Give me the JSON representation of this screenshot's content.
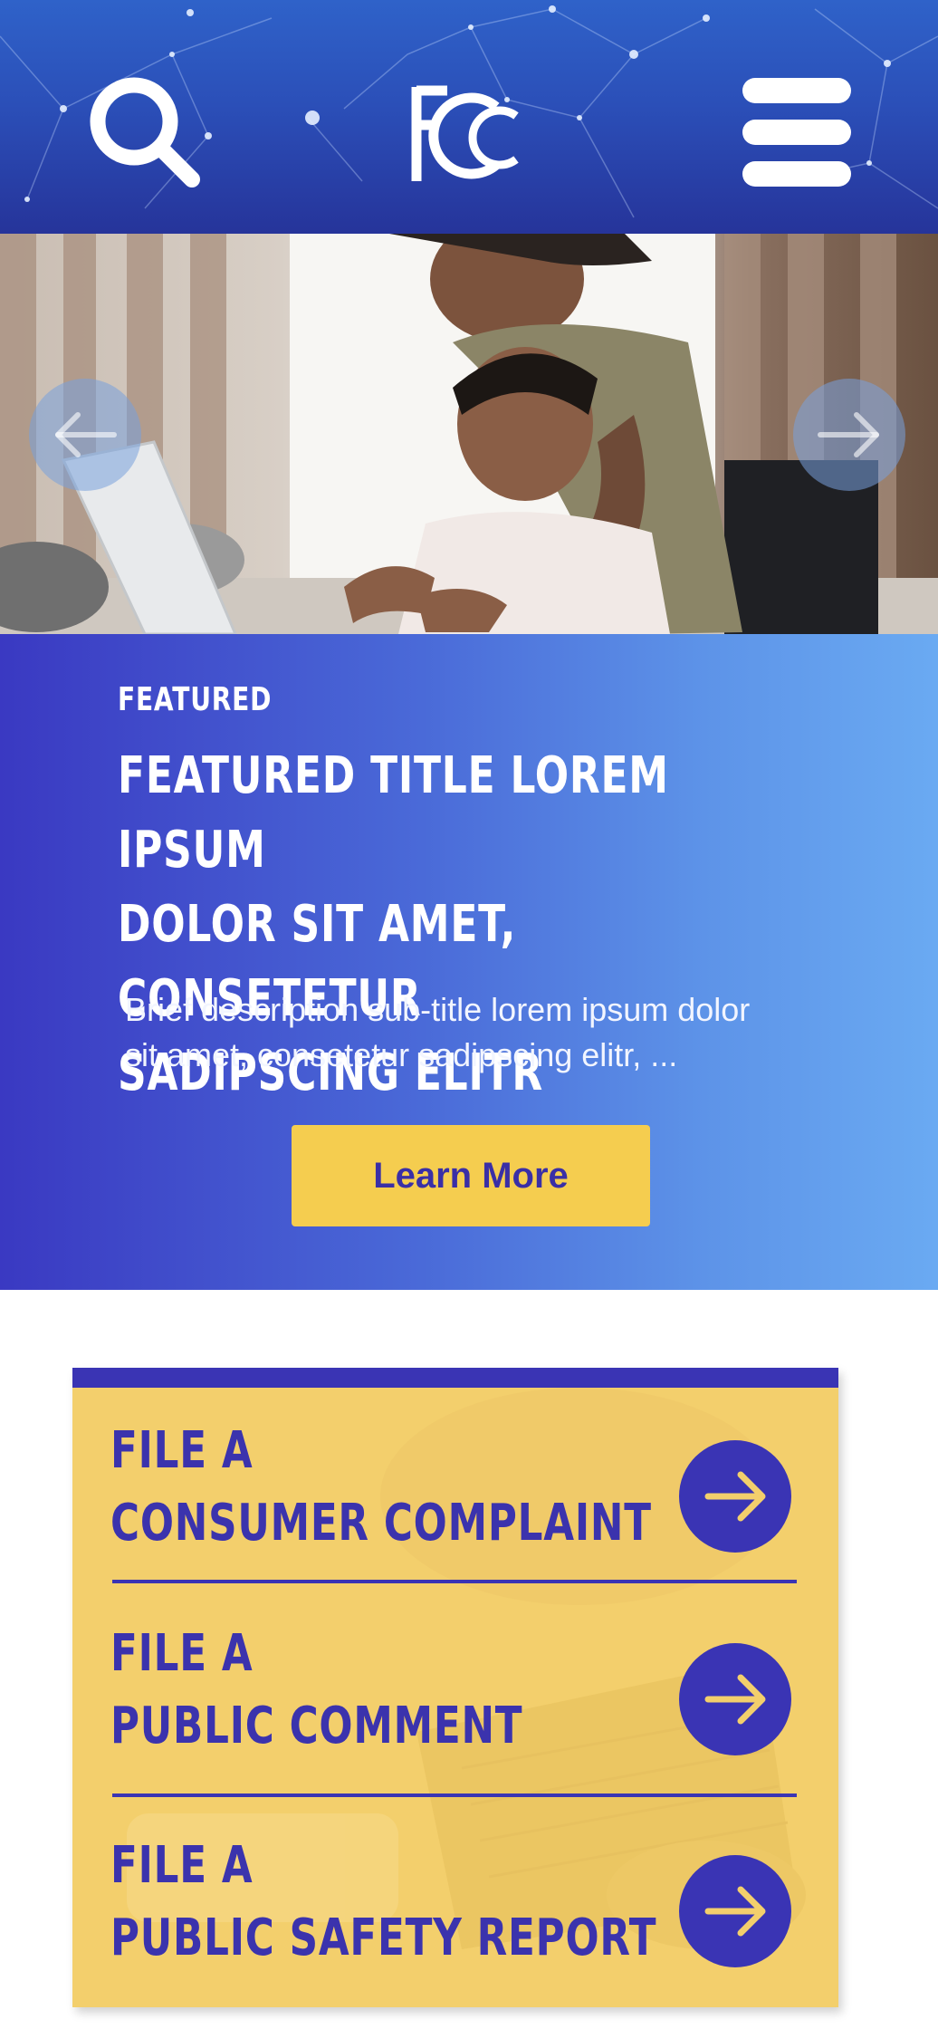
{
  "header": {
    "search_icon": "search-icon",
    "logo_text": "FCC",
    "menu_icon": "hamburger-menu-icon",
    "colors": {
      "top": "#2f62c9",
      "bottom": "#26349a"
    }
  },
  "hero": {
    "prev_icon": "arrow-left-icon",
    "next_icon": "arrow-right-icon"
  },
  "featured": {
    "kicker": "FEATURED",
    "title_lines": [
      "FEATURED TITLE LOREM IPSUM",
      "DOLOR SIT AMET, CONSETETUR",
      "SADIPSCING ELITR"
    ],
    "description_lines": [
      "Brief description sub-title lorem ipsum dolor",
      "sit amet, consetetur sadipscing elitr, ..."
    ],
    "cta_label": "Learn More",
    "colors": {
      "gradient_start": "#3a39c2",
      "gradient_end": "#6aaaf2",
      "cta": "#f5cd4f"
    }
  },
  "actions": {
    "items": [
      {
        "line1": "FILE A",
        "line2": "CONSUMER COMPLAINT",
        "icon": "arrow-right-icon"
      },
      {
        "line1": "FILE A",
        "line2": "PUBLIC COMMENT",
        "icon": "arrow-right-icon"
      },
      {
        "line1": "FILE A",
        "line2": "PUBLIC SAFETY REPORT",
        "icon": "arrow-right-icon"
      }
    ],
    "colors": {
      "card": "#f3cf6c",
      "accent": "#3a34b4"
    }
  }
}
